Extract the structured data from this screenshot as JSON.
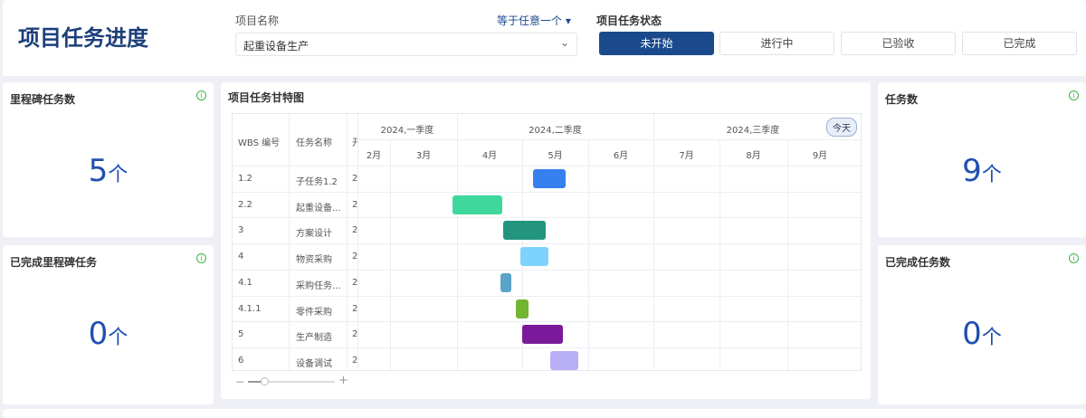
{
  "header": {
    "title": "项目任务进度",
    "project_label": "项目名称",
    "filter_mode": "等于任意一个",
    "project_value": "起重设备生产",
    "status_label": "项目任务状态",
    "status_buttons": [
      "未开始",
      "进行中",
      "已验收",
      "已完成"
    ],
    "active_status": "未开始"
  },
  "kpis": {
    "milestone": {
      "label": "里程碑任务数",
      "value": "5",
      "unit": "个"
    },
    "milestone_done": {
      "label": "已完成里程碑任务",
      "value": "0",
      "unit": "个"
    },
    "tasks": {
      "label": "任务数",
      "value": "9",
      "unit": "个"
    },
    "tasks_done": {
      "label": "已完成任务数",
      "value": "0",
      "unit": "个"
    }
  },
  "gantt": {
    "title": "项目任务甘特图",
    "columns": [
      "WBS 编号",
      "任务名称",
      "开始时间"
    ],
    "today": "今天",
    "quarters": [
      "2024,一季度",
      "2024,二季度",
      "2024,三季度"
    ],
    "months": [
      "2月",
      "3月",
      "4月",
      "5月",
      "6月",
      "7月",
      "8月",
      "9月"
    ],
    "rows": [
      {
        "wbs": "1.2",
        "name": "子任务1.2",
        "start": "2",
        "color": "#3580ee"
      },
      {
        "wbs": "2.2",
        "name": "起重设备...",
        "start": "2",
        "color": "#3ed89c"
      },
      {
        "wbs": "3",
        "name": "方案设计",
        "start": "2",
        "color": "#23957d"
      },
      {
        "wbs": "4",
        "name": "物资采购",
        "start": "2",
        "color": "#7dd3fc"
      },
      {
        "wbs": "4.1",
        "name": "采购任务...",
        "start": "2",
        "color": "#5ba3c7"
      },
      {
        "wbs": "4.1.1",
        "name": "零件采购",
        "start": "2",
        "color": "#72b533"
      },
      {
        "wbs": "5",
        "name": "生产制造",
        "start": "2",
        "color": "#7a1a9a"
      },
      {
        "wbs": "6",
        "name": "设备调试",
        "start": "2",
        "color": "#b8aef5"
      }
    ]
  }
}
